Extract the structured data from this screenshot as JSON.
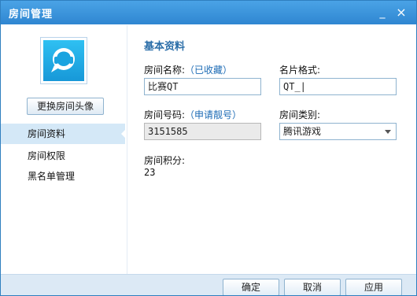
{
  "window": {
    "title": "房间管理",
    "minimize": "_",
    "close": "×"
  },
  "sidebar": {
    "change_avatar": "更换房间头像",
    "items": [
      {
        "label": "房间资料"
      },
      {
        "label": "房间权限"
      },
      {
        "label": "黑名单管理"
      }
    ]
  },
  "basic": {
    "section_title": "基本资料",
    "room_name_label": "房间名称:",
    "room_name_link": "（已收藏）",
    "room_name_value": "比赛QT",
    "card_format_label": "名片格式:",
    "card_format_value": "QT_|",
    "room_number_label": "房间号码:",
    "room_number_link": "（申请靓号）",
    "room_number_value": "3151585",
    "room_category_label": "房间类别:",
    "room_category_value": "腾讯游戏",
    "room_points_label": "房间积分:",
    "room_points_value": "23"
  },
  "footer": {
    "ok": "确定",
    "cancel": "取消",
    "apply": "应用"
  }
}
